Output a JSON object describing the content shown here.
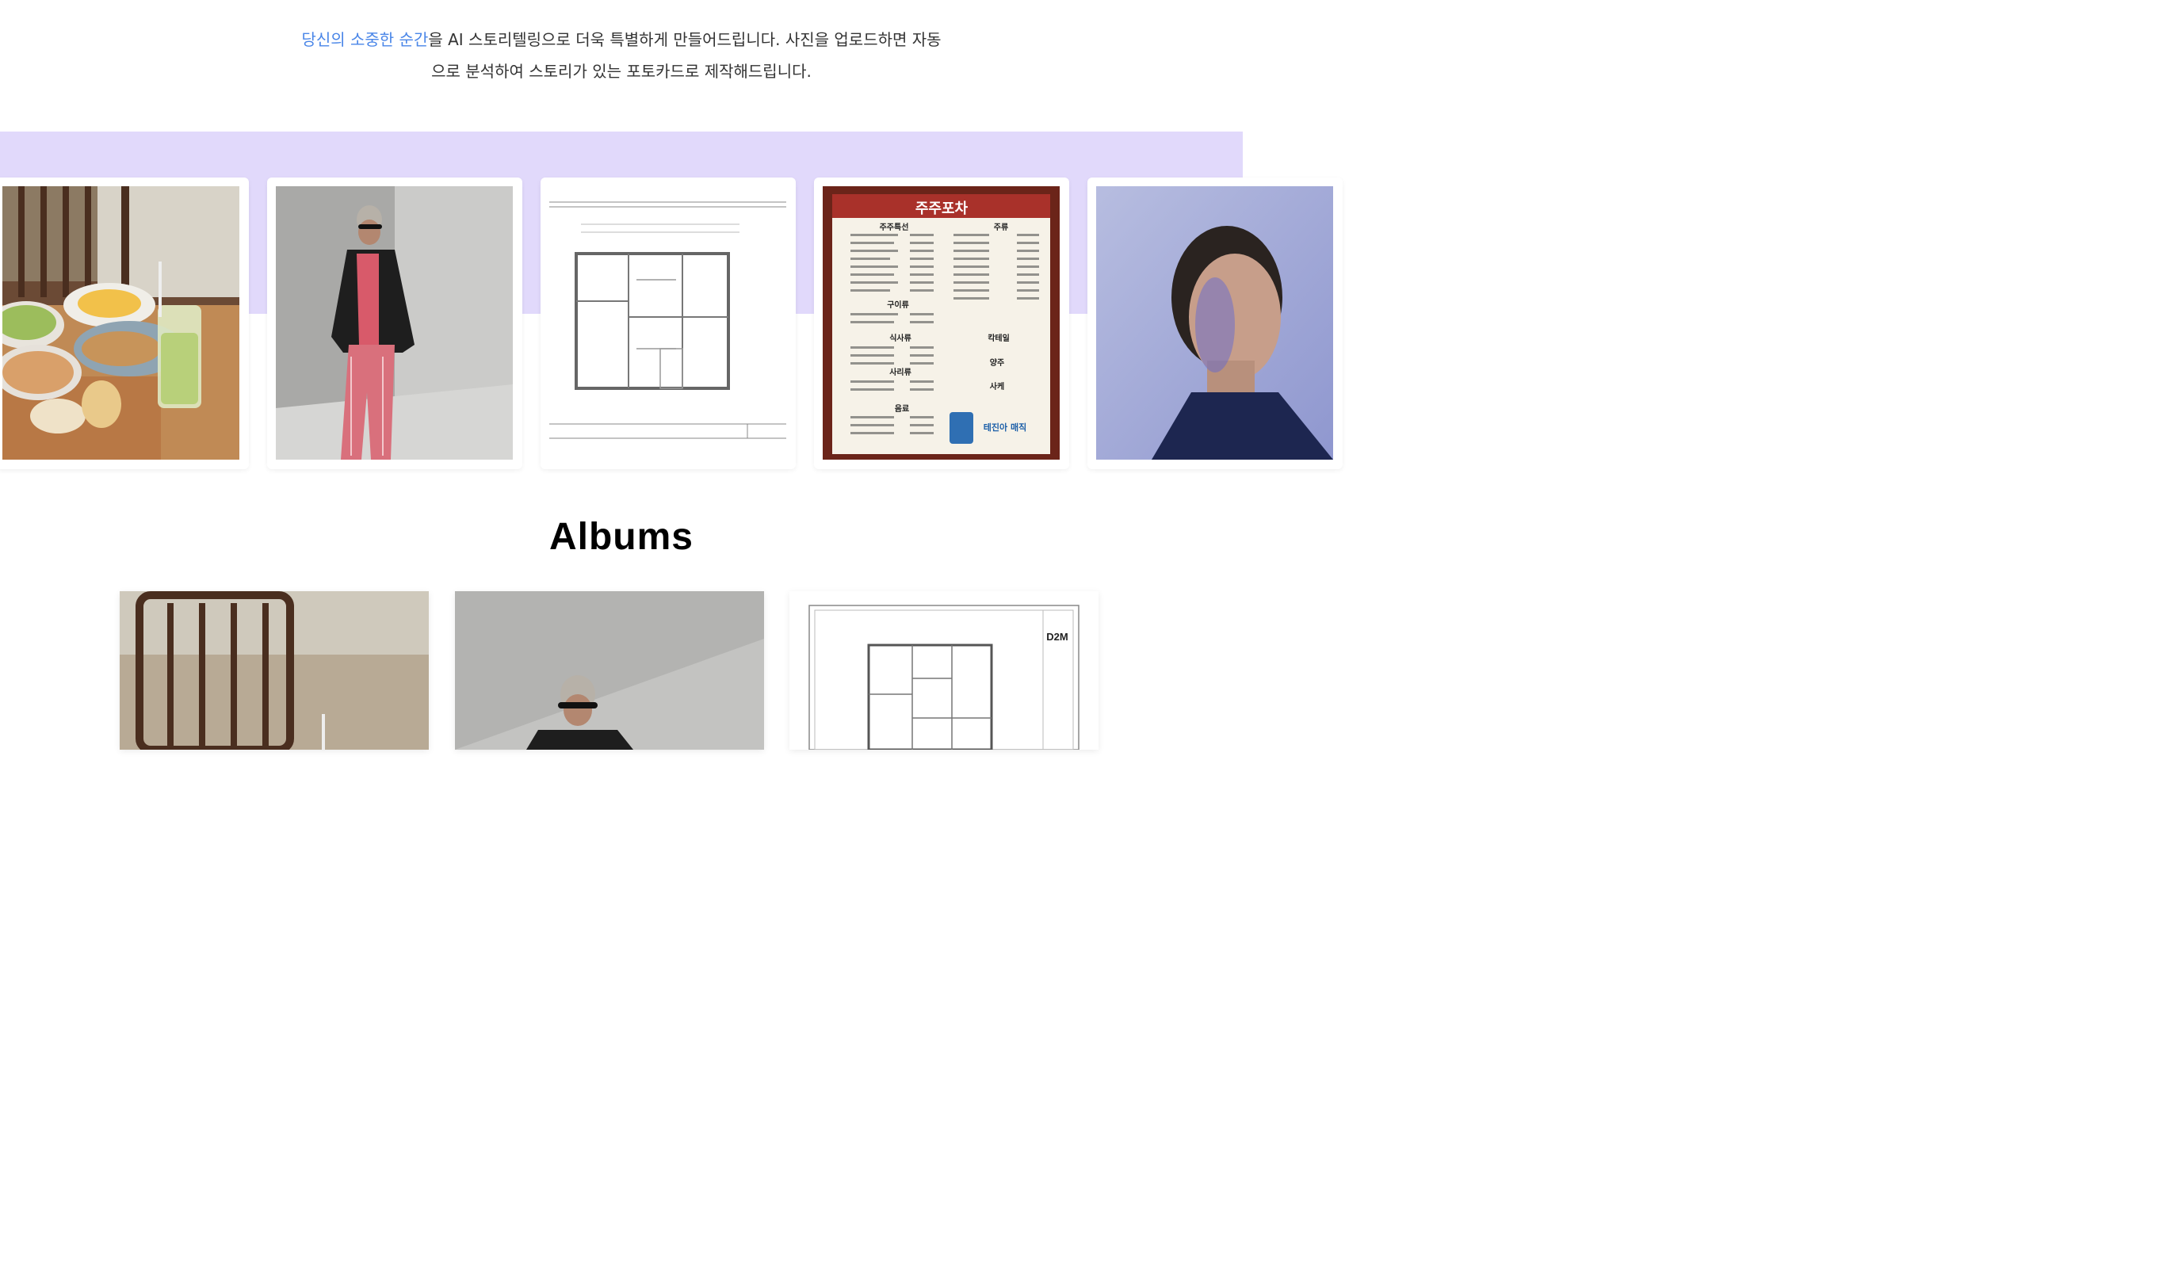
{
  "intro": {
    "highlight": "당신의 소중한 순간",
    "line1_rest": "을 AI 스토리텔링으로 더욱 특별하게 만들어드립니다. 사진을 업로드하면 자동",
    "line2": "으로 분석하여 스토리가 있는 포토카드로 제작해드립니다."
  },
  "colors": {
    "accent": "#4a86e8",
    "band": "#e1d9fb"
  },
  "carousel": [
    {
      "name": "food-photo"
    },
    {
      "name": "fashion-photo"
    },
    {
      "name": "floor-plan-photo"
    },
    {
      "name": "menu-photo",
      "menu": {
        "title": "주주포차",
        "sec_special": "주주특선",
        "sec_drinks": "주류",
        "sec_grill": "구이류",
        "sec_meal": "식사류",
        "sec_side": "사리류",
        "sec_cocktail": "칵테일",
        "sec_liquor": "양주",
        "sec_sake": "사케",
        "sec_beverage": "음료",
        "promo": "테진아 매직"
      }
    },
    {
      "name": "portrait-photo"
    }
  ],
  "albums": {
    "title": "Albums",
    "items": [
      {
        "name": "album-food"
      },
      {
        "name": "album-fashion"
      },
      {
        "name": "album-floor-plan",
        "logo": "D2M"
      }
    ]
  }
}
